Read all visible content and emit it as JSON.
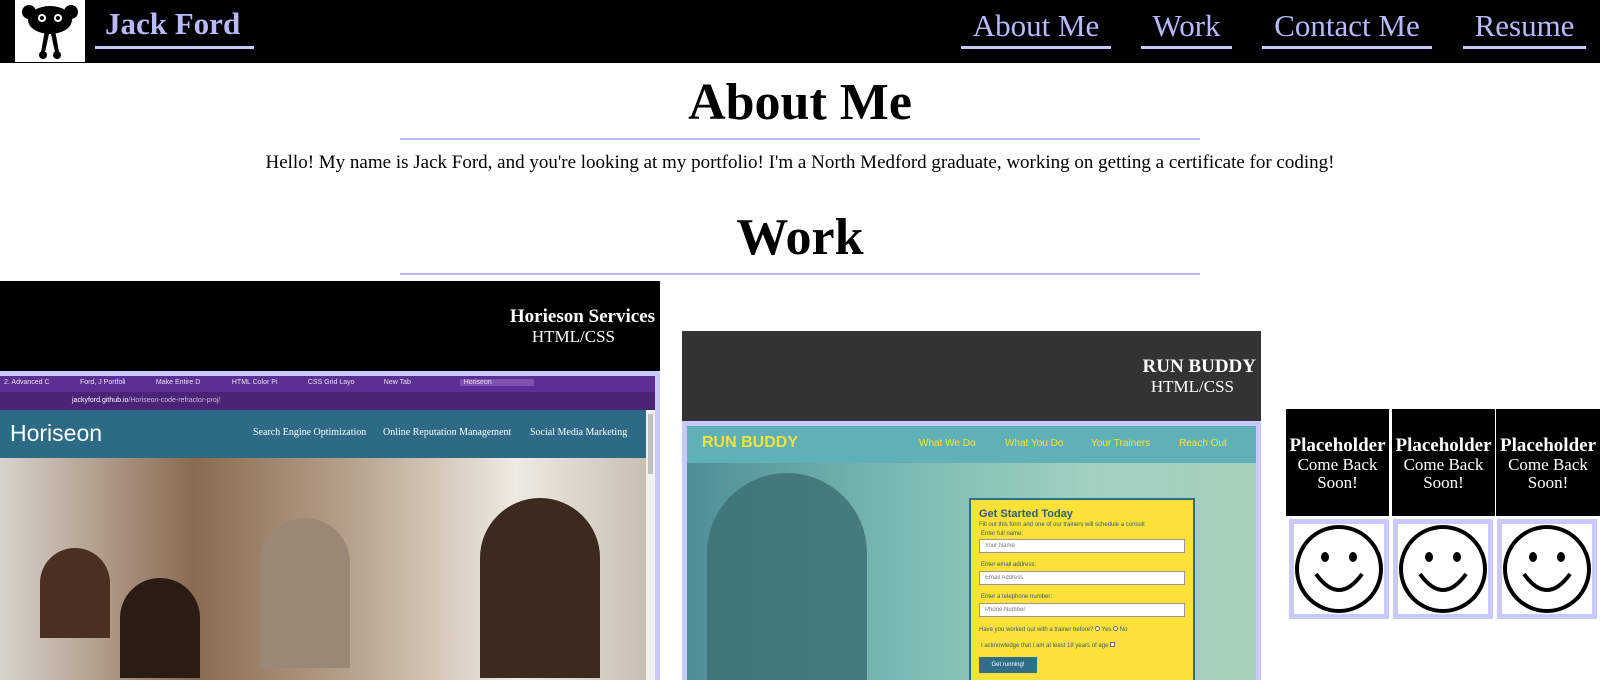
{
  "header": {
    "site_title": "Jack Ford",
    "logo": "ghost-face-logo",
    "nav": [
      {
        "label": "About Me"
      },
      {
        "label": "Work"
      },
      {
        "label": "Contact Me"
      },
      {
        "label": "Resume"
      }
    ]
  },
  "about": {
    "title": "About Me",
    "text": "Hello! My name is Jack Ford, and you're looking at my portfolio! I'm a North Medford graduate, working on getting a certificate for coding!"
  },
  "work": {
    "title": "Work",
    "projects": [
      {
        "name": "Horieson Services",
        "tech": "HTML/CSS",
        "screenshot": {
          "tabs": [
            "2. Advanced C",
            "Ford, J Portfoli",
            "Make Entire D",
            "HTML Color Pi",
            "CSS Grid Layo",
            "New Tab",
            "Horiseon"
          ],
          "url_host": "jackyford.github.io",
          "url_path": "/Horiseon-code-refractor-proj/",
          "brand": "Horiseon",
          "nav": [
            "Search Engine Optimization",
            "Online Reputation Management",
            "Social Media Marketing"
          ]
        }
      },
      {
        "name": "RUN BUDDY",
        "tech": "HTML/CSS",
        "screenshot": {
          "brand": "RUN BUDDY",
          "nav": [
            "What We Do",
            "What You Do",
            "Your Trainers",
            "Reach Out"
          ],
          "form_title": "Get Started Today",
          "form_intro": "Fill out this form and one of our trainers will schedule a consult",
          "name_label": "Enter full name:",
          "name_placeholder": "Your Name",
          "email_label": "Enter email address:",
          "email_placeholder": "Email Address",
          "phone_label": "Enter a telephone number:",
          "phone_placeholder": "Phone Number",
          "trainer_question": "Have you worked out with a trainer before?",
          "yes": "Yes",
          "no": "No",
          "ack": "I acknowledge that I am at least 18 years of age",
          "submit": "Get running!"
        }
      }
    ],
    "placeholders": [
      {
        "name": "Placeholder",
        "tech": "Come Back Soon!"
      },
      {
        "name": "Placeholder",
        "tech": "Come Back Soon!"
      },
      {
        "name": "Placeholder",
        "tech": "Come Back Soon!"
      }
    ]
  },
  "colors": {
    "nav_text": "#b9b9ff",
    "card_border": "#c9c9ff",
    "run_buddy_header": "#333333",
    "horiseon_blue": "#1f6e8c",
    "run_buddy_teal": "#4aa3a8",
    "run_buddy_yellow": "#fce138"
  }
}
